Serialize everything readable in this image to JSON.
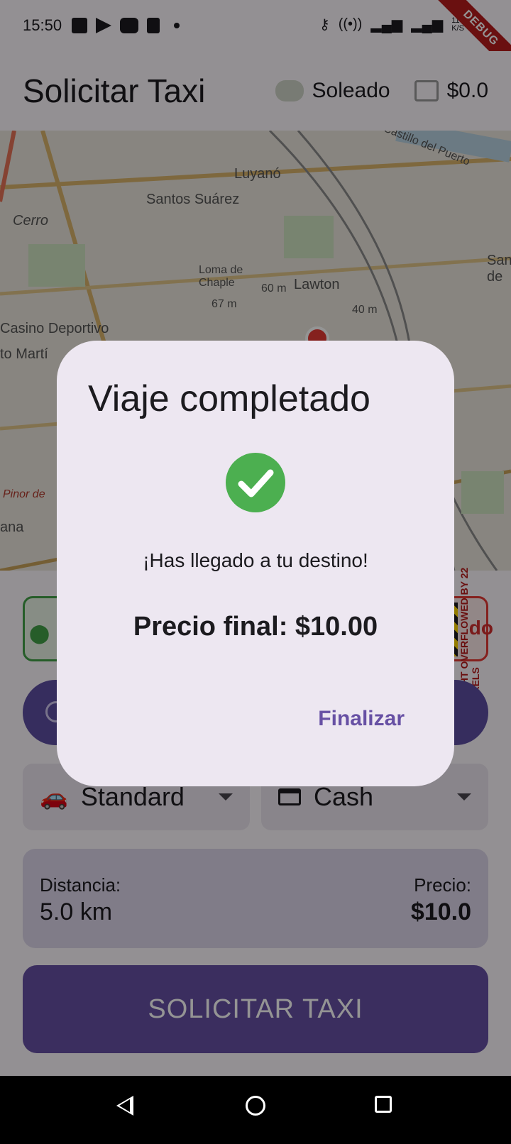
{
  "status_bar": {
    "time": "15:50",
    "icons": [
      "facebook-icon",
      "telegram-icon",
      "youtube-icon",
      "sd-card-icon",
      "notification-dot-icon"
    ],
    "right_icons": [
      "key-icon",
      "hotspot-icon",
      "lte-signal-icon",
      "signal-icon",
      "data-speed-icon",
      "battery-charging-icon"
    ],
    "data_speed": "110\nK/S",
    "debug_label": "DEBUG"
  },
  "app_bar": {
    "title": "Solicitar Taxi",
    "weather_label": "Soleado",
    "balance": "$0.0"
  },
  "map": {
    "labels": [
      "Luyanó",
      "Santos Suárez",
      "Cerro",
      "Loma de\nChaple",
      "60 m",
      "67 m",
      "Lawton",
      "40 m",
      "Casino Deportivo",
      "to Martí",
      "Pinor de",
      "ana",
      "San\nde",
      "Castillo del Puerto"
    ]
  },
  "overflow_warning": "RIGHT OVERFLOWED BY 22 PIXELS",
  "destination_partial": "do",
  "vehicle_dropdown": {
    "label": "Standard",
    "icon": "car-icon"
  },
  "payment_dropdown": {
    "label": "Cash",
    "icon": "credit-card-icon"
  },
  "summary": {
    "distance_label": "Distancia:",
    "distance_value": "5.0 km",
    "price_label": "Precio:",
    "price_value": "$10.0"
  },
  "request_button": "SOLICITAR TAXI",
  "dialog": {
    "title": "Viaje completado",
    "message": "¡Has llegado a tu destino!",
    "final_price": "Precio final: $10.00",
    "action": "Finalizar"
  },
  "colors": {
    "primary": "#6750a4",
    "success": "#4caf50",
    "origin_border": "#43a047",
    "dest_border": "#e53935",
    "debug_ribbon": "#b71c1c"
  }
}
